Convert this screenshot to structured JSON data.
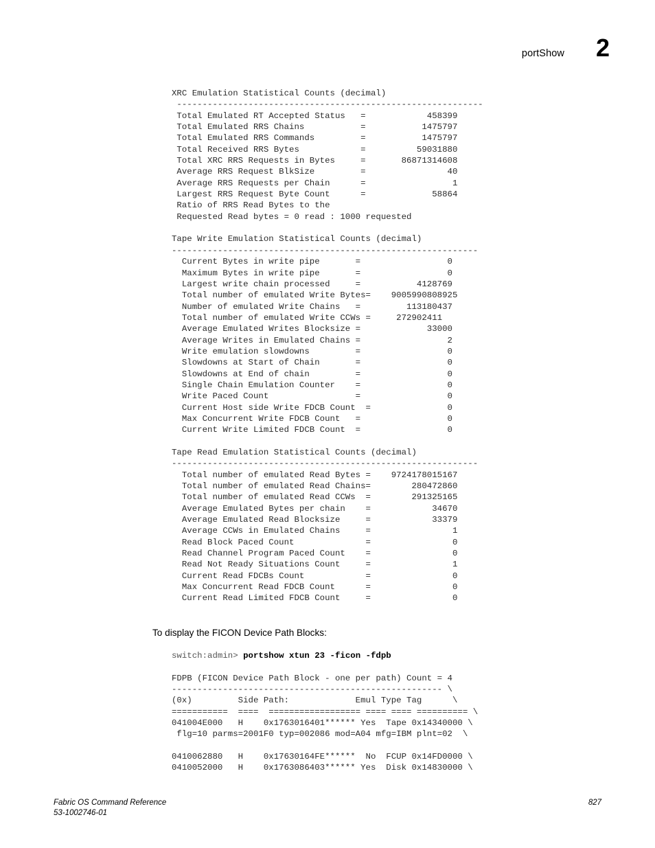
{
  "header": {
    "topic": "portShow",
    "chapter": "2"
  },
  "blocks": {
    "xrc": "XRC Emulation Statistical Counts (decimal)\n ------------------------------------------------------------\n Total Emulated RT Accepted Status   =            458399\n Total Emulated RRS Chains           =           1475797\n Total Emulated RRS Commands         =           1475797\n Total Received RRS Bytes            =          59031880\n Total XRC RRS Requests in Bytes     =       86871314608\n Average RRS Request BlkSize         =                40\n Average RRS Requests per Chain      =                 1\n Largest RRS Request Byte Count      =             58864\n Ratio of RRS Read Bytes to the\n Requested Read bytes = 0 read : 1000 requested",
    "tape_write": "Tape Write Emulation Statistical Counts (decimal)\n------------------------------------------------------------\n  Current Bytes in write pipe       =                 0\n  Maximum Bytes in write pipe       =                 0\n  Largest write chain processed     =           4128769\n  Total number of emulated Write Bytes=    9005990808925\n  Number of emulated Write Chains   =         113180437\n  Total number of emulated Write CCWs =     272902411\n  Average Emulated Writes Blocksize =             33000\n  Average Writes in Emulated Chains =                 2\n  Write emulation slowdowns         =                 0\n  Slowdowns at Start of Chain       =                 0\n  Slowdowns at End of chain         =                 0\n  Single Chain Emulation Counter    =                 0\n  Write Paced Count                 =                 0\n  Current Host side Write FDCB Count  =               0\n  Max Concurrent Write FDCB Count   =                 0\n  Current Write Limited FDCB Count  =                 0",
    "tape_read": "Tape Read Emulation Statistical Counts (decimal)\n------------------------------------------------------------\n  Total number of emulated Read Bytes =    9724178015167\n  Total number of emulated Read Chains=        280472860\n  Total number of emulated Read CCWs  =        291325165\n  Average Emulated Bytes per chain    =            34670\n  Average Emulated Read Blocksize     =            33379\n  Average CCWs in Emulated Chains     =                1\n  Read Block Paced Count              =                0\n  Read Channel Program Paced Count    =                0\n  Read Not Ready Situations Count     =                1\n  Current Read FDCBs Count            =                0\n  Max Concurrent Read FDCB Count      =                0\n  Current Read Limited FDCB Count     =                0",
    "fdpb": "FDPB (FICON Device Path Block - one per path) Count = 4\n----------------------------------------------------- \\\n(0x)         Side Path:             Emul Type Tag      \\\n===========  ====  ================== ==== ==== ========== \\\n041004E000   H    0x1763016401****** Yes  Tape 0x14340000 \\\n flg=10 parms=2001F0 typ=002086 mod=A04 mfg=IBM plnt=02  \\\n\n0410062880   H    0x17630164FE******  No  FCUP 0x14FD0000 \\\n0410052000   H    0x1763086403****** Yes  Disk 0x14830000 \\"
  },
  "instruction": "To display the FICON Device Path Blocks:",
  "command": {
    "prompt": "switch:admin> ",
    "text": "portshow xtun 23 -ficon -fdpb"
  },
  "footer": {
    "title": "Fabric OS Command Reference",
    "doc_number": "53-1002746-01",
    "page_number": "827"
  }
}
